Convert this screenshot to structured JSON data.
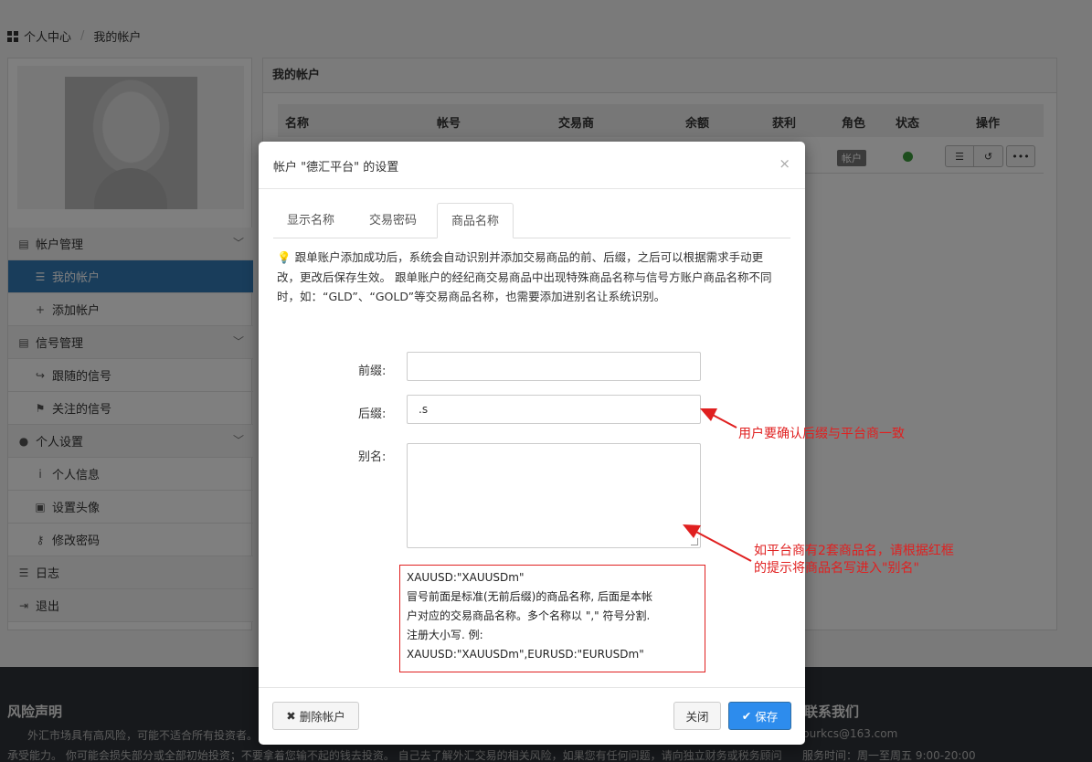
{
  "breadcrumb": {
    "home": "个人中心",
    "current": "我的帐户"
  },
  "sidebar": {
    "groups": [
      {
        "label": "帐户管理",
        "items": [
          "我的帐户",
          "添加帐户"
        ]
      },
      {
        "label": "信号管理",
        "items": [
          "跟随的信号",
          "关注的信号"
        ]
      },
      {
        "label": "个人设置",
        "items": [
          "个人信息",
          "设置头像",
          "修改密码"
        ]
      }
    ],
    "log": "日志",
    "logout": "退出"
  },
  "panel": {
    "title": "我的帐户",
    "columns": [
      "名称",
      "帐号",
      "交易商",
      "余额",
      "获利",
      "角色",
      "状态",
      "操作"
    ],
    "row": {
      "role": "帐户",
      "status_color": "#3a9b3a"
    }
  },
  "footer": {
    "risk_title": "风险声明",
    "risk_line1": "外汇市场具有高风险，可能不适合所有投资者。",
    "risk_line2": "承受能力。 你可能会损失部分或全部初始投资；不要拿着您输不起的钱去投资。 自己去了解外汇交易的相关风险，如果您有任何问题，请向独立财务或税务顾问",
    "contact_title": "联系我们",
    "contact_email": "burkcs@163.com",
    "service_hours": "服务时间：周一至周五 9:00-20:00"
  },
  "modal": {
    "title": "帐户 \"德汇平台\" 的设置",
    "close_glyph": "×",
    "tabs": [
      "显示名称",
      "交易密码",
      "商品名称"
    ],
    "active_tab": 2,
    "notice": "跟单账户添加成功后，系统会自动识别并添加交易商品的前、后缀，之后可以根据需求手动更改，更改后保存生效。 跟单账户的经纪商交易商品中出现特殊商品名称与信号方账户商品名称不同时，如：“GLD”、“GOLD”等交易商品名称，也需要添加进别名让系统识别。",
    "prefix_label": "前缀:",
    "prefix_value": "",
    "suffix_label": "后缀:",
    "suffix_value": ".s",
    "alias_label": "别名:",
    "alias_value": "",
    "hint_lines": [
      "XAUUSD:\"XAUUSDm\"",
      "冒号前面是标准(无前后缀)的商品名称, 后面是本帐",
      "户对应的交易商品名称。多个名称以 \",\" 符号分割.",
      "注册大小写. 例:",
      "XAUUSD:\"XAUUSDm\",EURUSD:\"EURUSDm\""
    ],
    "delete_label": "删除帐户",
    "close_label": "关闭",
    "save_label": "保存"
  },
  "annotations": {
    "suffix_note": "用户要确认后缀与平台商一致",
    "alias_note_line1": "如平台商有2套商品名，请根据红框",
    "alias_note_line2": "的提示将商品名写进入\"别名\"",
    "color": "#e02020"
  }
}
